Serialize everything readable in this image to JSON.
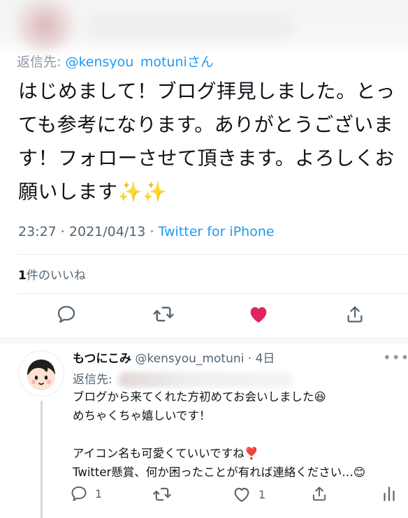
{
  "tweet": {
    "reply_to_prefix": "返信先:",
    "reply_to_handle": "@kensyou_motuniさん",
    "text": "はじめまして！ブログ拝見しました。とっても参考になります。ありがとうございます！フォローさせて頂きます。よろしくお願いします✨✨",
    "time": "23:27",
    "date": "2021/04/13",
    "source": "Twitter for iPhone",
    "like_count": "1",
    "likes_label": "件のいいね"
  },
  "actions": {
    "reply_icon": "reply-icon",
    "retweet_icon": "retweet-icon",
    "like_icon": "heart-filled-icon",
    "share_icon": "share-icon",
    "like_color": "#e0245e"
  },
  "reply": {
    "name": "もつにこみ",
    "handle": "@kensyou_motuni",
    "age": "4日",
    "reply_to_prefix": "返信先:",
    "text": "ブログから来てくれた方初めてお会いしました😆\nめちゃくちゃ嬉しいです！\n\nアイコン名も可愛くていいですね❣️\nTwitter懸賞、何か困ったことが有れば連絡ください…😊",
    "reply_count": "1",
    "like_count": "1"
  }
}
